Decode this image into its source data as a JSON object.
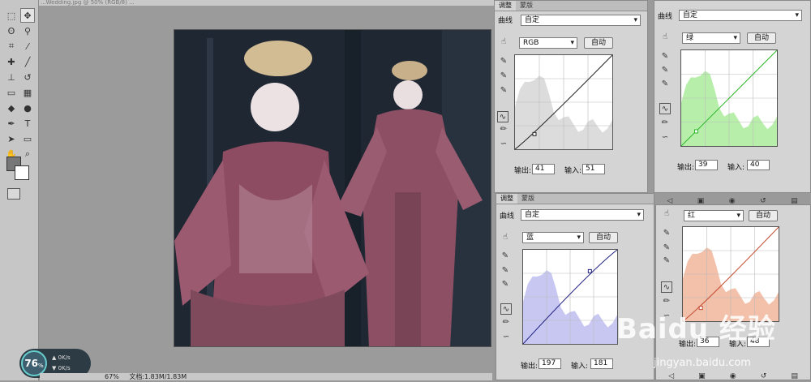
{
  "window": {
    "title_fragment": "...Wedding.jpg @ 50% (RGB/8) ..."
  },
  "status": {
    "zoom": "67%",
    "doc_label": "文档:1.83M/1.83M"
  },
  "netmon": {
    "percent": "76",
    "percent_unit": "%",
    "up": "0K/s",
    "down": "0K/s"
  },
  "tabs": {
    "adjust": "调整",
    "masks": "蒙版"
  },
  "curve_label": "曲线",
  "preset_value": "自定",
  "auto_label": "自动",
  "output_label": "输出:",
  "input_label": "输入:",
  "panels": {
    "rgb": {
      "channel": "RGB",
      "output": "41",
      "input": "51",
      "color": "#222222",
      "hist": "#dcdcdc"
    },
    "green": {
      "channel": "绿",
      "output": "39",
      "input": "40",
      "color": "#2bb52b",
      "hist": "#b7efaa"
    },
    "blue": {
      "channel": "蓝",
      "output": "197",
      "input": "181",
      "color": "#202080",
      "hist": "#c7c7f2"
    },
    "red": {
      "channel": "红",
      "output": "36",
      "input": "48",
      "color": "#c24c32",
      "hist": "#f3c0aa"
    }
  },
  "watermark": {
    "text": "Baidu 经验",
    "url": "jingyan.baidu.com"
  },
  "icons": [
    "move-icon",
    "marquee-icon",
    "lasso-icon",
    "magic-wand-icon",
    "crop-icon",
    "eyedropper-icon",
    "healing-icon",
    "brush-icon",
    "stamp-icon",
    "history-brush-icon",
    "eraser-icon",
    "gradient-icon",
    "blur-icon",
    "dodge-icon",
    "pen-icon",
    "type-icon",
    "path-select-icon",
    "shape-icon",
    "hand-icon",
    "zoom-icon"
  ]
}
